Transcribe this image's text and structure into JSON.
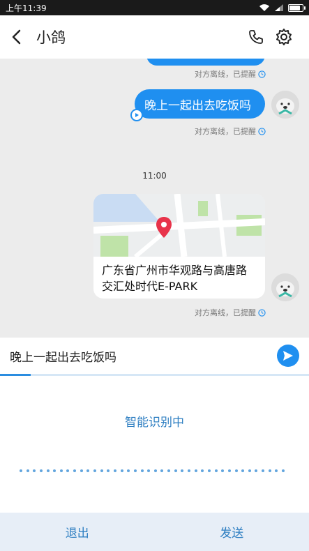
{
  "status_bar": {
    "time": "上午11:39"
  },
  "header": {
    "title": "小鸽",
    "icons": [
      "back-icon",
      "phone-icon",
      "settings-icon"
    ]
  },
  "chat": {
    "messages": [
      {
        "type": "text",
        "text": "",
        "status": "对方离线，已提醒"
      },
      {
        "type": "text",
        "text": "晚上一起出去吃饭吗",
        "status": "对方离线，已提醒"
      },
      {
        "type": "location",
        "address": "广东省广州市华观路与高唐路交汇处时代E-PARK",
        "status": "对方离线，已提醒"
      }
    ],
    "time_separator": "11:00"
  },
  "input": {
    "value": "晚上一起出去吃饭吗",
    "progress": 0.1
  },
  "voice": {
    "status_text": "智能识别中"
  },
  "bottom": {
    "exit_label": "退出",
    "send_label": "发送"
  },
  "colors": {
    "accent": "#1f8ff0",
    "voice_text": "#2f7fc2"
  }
}
